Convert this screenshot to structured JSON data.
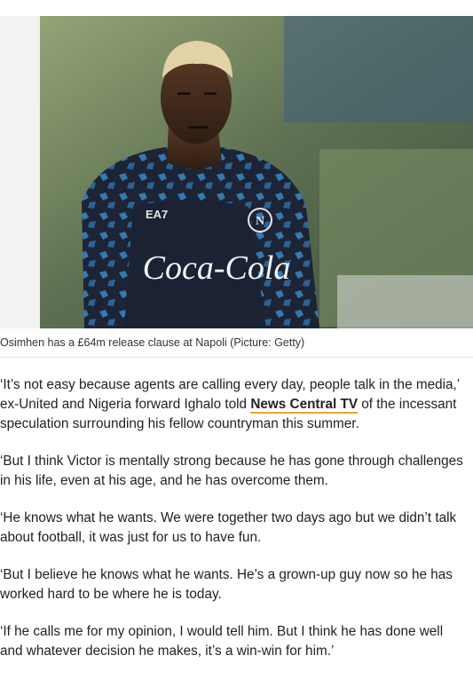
{
  "photo": {
    "subject": "Footballer in dark blue training jersey with blond hair",
    "jersey_brand": "EA7",
    "jersey_sponsor": "Coca-Cola",
    "crest_letter": "N"
  },
  "caption": {
    "text": "Osimhen has a £64m release clause at Napoli (Picture: Getty)"
  },
  "article": {
    "paragraphs": [
      {
        "before": "‘It’s not easy because agents are calling every day, people talk in the media,’ ex-United and Nigeria forward Ighalo told ",
        "link": "News Central TV",
        "after": " of the incessant speculation surrounding his fellow countryman this summer."
      },
      {
        "text": "‘But I think Victor is mentally strong because he has gone through challenges in his life, even at his age, and he has overcome them."
      },
      {
        "text": "‘He knows what he wants. We were together two days ago but we didn’t talk about football, it was just for us to have fun."
      },
      {
        "text": "‘But I believe he knows what he wants. He’s a grown-up guy now so he has worked hard to be where he is today."
      },
      {
        "text": "‘If he calls me for my opinion, I would tell him. But I think he has done well and whatever decision he makes, it’s a win-win for him.’"
      }
    ]
  },
  "colors": {
    "link_underline": "#e8a62f",
    "text": "#222222",
    "jersey": "#1c2436",
    "jersey_accent": "#3b8fd0"
  }
}
